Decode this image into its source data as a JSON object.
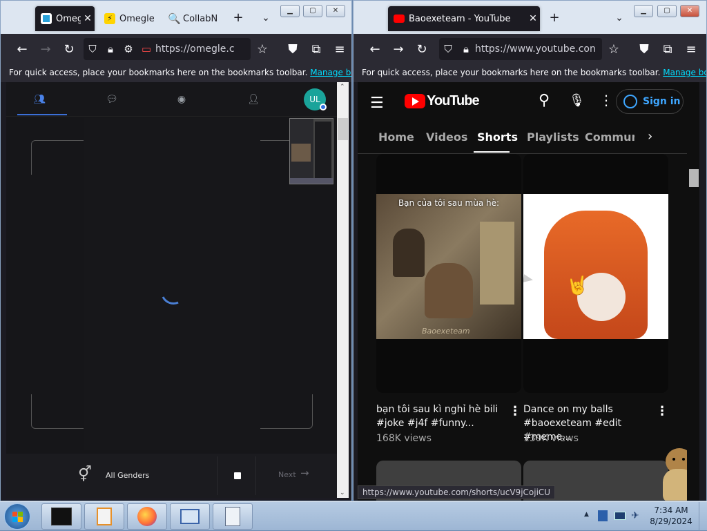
{
  "left_window": {
    "tabs": [
      {
        "title": "Omegle",
        "favicon": "omegle-icon",
        "active": true
      },
      {
        "title": "Omegle",
        "favicon": "lightning-icon",
        "active": false
      },
      {
        "title": "CollabNe",
        "favicon": "search-icon",
        "active": false
      }
    ],
    "new_tab": "+",
    "url": "https://omegle.c",
    "bookmarks_text": "For quick access, place your bookmarks here on the bookmarks toolbar.",
    "bookmarks_link": "Manage bookmarks",
    "omegle": {
      "avatar_text": "UL",
      "gender_label": "All Genders",
      "next_label": "Next"
    }
  },
  "right_window": {
    "tab": {
      "title": "Baoexeteam - YouTube",
      "favicon": "youtube-icon"
    },
    "url": "https://www.youtube.con",
    "bookmarks_text": "For quick access, place your bookmarks here on the bookmarks toolbar.",
    "bookmarks_link": "Manage bookmarks",
    "youtube": {
      "logo_text": "YouTube",
      "sign_in": "Sign in",
      "tabs": [
        "Home",
        "Videos",
        "Shorts",
        "Playlists",
        "Communi"
      ],
      "selected_tab": "Shorts",
      "videos": [
        {
          "thumb_caption": "Bạn của tôi sau mùa hè:",
          "thumb_watermark": "Baoexeteam",
          "title_line1": "bạn tôi sau kì nghỉ hè bili",
          "title_line2": "#joke #j4f #funny...",
          "views": "168K views"
        },
        {
          "title_line1": "Dance on my balls",
          "title_line2": "#baoexeteam #edit #meme...",
          "views": "139K views"
        }
      ],
      "status_url": "https://www.youtube.com/shorts/ucV9jCojiCU"
    }
  },
  "taskbar": {
    "time": "7:34 AM",
    "date": "8/29/2024",
    "tray_arrow": "▲"
  },
  "colors": {
    "yt_red": "#ff0000",
    "firefox_dark": "#1c1b22",
    "link": "#00ddff",
    "signin_blue": "#3ea6ff",
    "avatar_teal": "#1aa39a"
  }
}
